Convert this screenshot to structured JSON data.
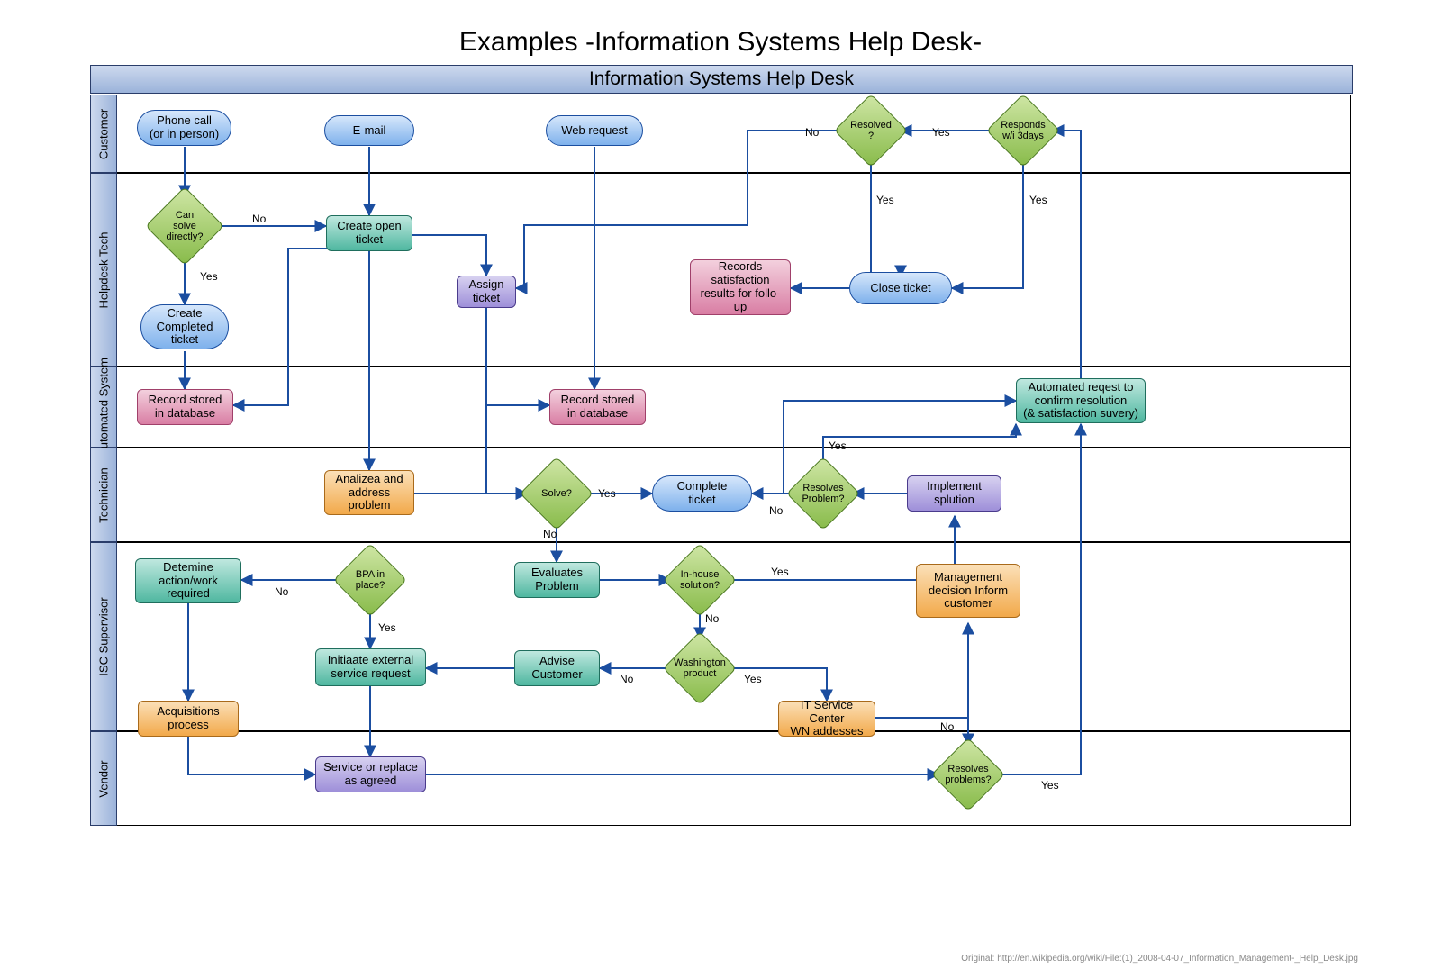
{
  "title": "Examples -Information Systems Help Desk-",
  "banner": "Information Systems Help Desk",
  "lanes": {
    "customer": "Customer",
    "helpdesk": "Helpdesk Tech",
    "auto": "Automated System",
    "tech": "Technician",
    "isc": "ISC Supervisor",
    "vendor": "Vendor"
  },
  "nodes": {
    "phone": "Phone call\n(or in person)",
    "email": "E-mail",
    "web": "Web request",
    "resolved": "Resolved\n?",
    "responds": "Responds\nw/i 3days",
    "cansolve": "Can\nsolve\ndirectly?",
    "createopen": "Create open\nticket",
    "assign": "Assign ticket",
    "createcomp": "Create\nCompleted\nticket",
    "close": "Close ticket",
    "recsat": "Records\nsatisfaction\nresults for follo-\nup",
    "recdb1": "Record stored\nin database",
    "recdb2": "Record stored\nin database",
    "autoreq": "Automated reqest to\nconfirm resolution\n(& satisfaction suvery)",
    "analyze": "Analizea and\naddress\nproblem",
    "solve": "Solve?",
    "compticket": "Complete\nticket",
    "resprob": "Resolves\nProblem?",
    "implsol": "Implement\nsplution",
    "detwork": "Detemine\naction/work\nrequired",
    "bpa": "BPA in\nplace?",
    "evalprob": "Evaluates\nProblem",
    "inhouse": "In-house\nsolution?",
    "mgmt": "Management\ndecision Inform\ncustomer",
    "initext": "Initiaate external\nservice request",
    "advise": "Advise\nCustomer",
    "washprod": "Washington\nproduct",
    "itservice": "IT Service Center\nWN addesses",
    "acq": "Acquisitions\nprocess",
    "svc": "Service or replace\nas agreed",
    "resprobv": "Resolves\nproblems?"
  },
  "labels": {
    "no": "No",
    "yes": "Yes"
  },
  "footer": "Original: http://en.wikipedia.org/wiki/File:(1)_2008-04-07_Information_Management-_Help_Desk.jpg"
}
